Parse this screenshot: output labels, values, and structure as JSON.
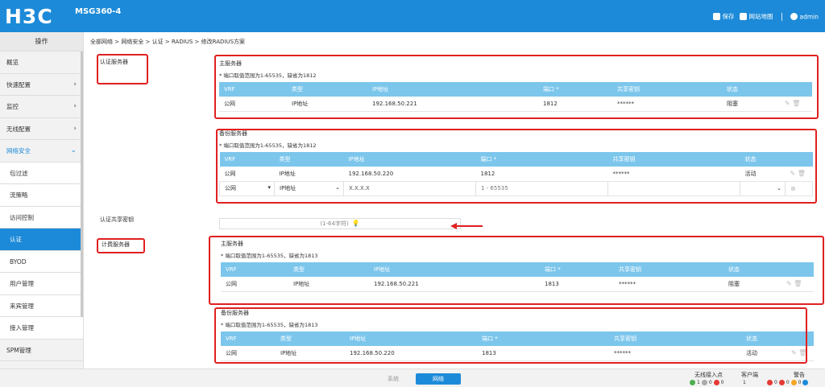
{
  "header": {
    "logo": "H3C",
    "model": "MSG360-4",
    "save_label": "保存",
    "sitemap_label": "网站地图",
    "user_label": "admin"
  },
  "sidebar": {
    "title": "操作",
    "items": [
      {
        "label": "概览",
        "chev": ""
      },
      {
        "label": "快速配置",
        "chev": "›"
      },
      {
        "label": "监控",
        "chev": "›"
      },
      {
        "label": "无线配置",
        "chev": "›"
      },
      {
        "label": "网络安全",
        "chev": "⌄"
      },
      {
        "label": "包过滤",
        "chev": ""
      },
      {
        "label": "流策略",
        "chev": ""
      },
      {
        "label": "访问控制",
        "chev": ""
      },
      {
        "label": "认证",
        "chev": ""
      },
      {
        "label": "BYOD",
        "chev": ""
      },
      {
        "label": "用户管理",
        "chev": ""
      },
      {
        "label": "来宾管理",
        "chev": ""
      },
      {
        "label": "接入管理",
        "chev": ""
      },
      {
        "label": "SPM管理",
        "chev": ""
      }
    ]
  },
  "breadcrumb": "全部网络 > 网络安全 > 认证 > RADIUS > 修改RADIUS方案",
  "labels": {
    "auth_server": "认证服务器",
    "auth_shared_key": "认证共享密钥",
    "acct_server": "计费服务器"
  },
  "columns": [
    "VRF",
    "类型",
    "IP地址",
    "端口 *",
    "共享密钥",
    "状态"
  ],
  "auth_primary": {
    "title": "主服务器",
    "note": "* 端口取值范围为1-65535，缺省为1812",
    "row": {
      "vrf": "公网",
      "type": "IP地址",
      "ip": "192.168.50.221",
      "port": "1812",
      "key": "******",
      "status": "阻塞"
    }
  },
  "auth_backup": {
    "title": "备份服务器",
    "note": "* 端口取值范围为1-65535，缺省为1812",
    "row": {
      "vrf": "公网",
      "type": "IP地址",
      "ip": "192.168.50.220",
      "port": "1812",
      "key": "******",
      "status": "活动"
    },
    "new_row": {
      "vrf": "公网",
      "type": "IP地址",
      "ip_placeholder": "X.X.X.X",
      "port_placeholder": "1 - 65535"
    }
  },
  "shared_key_hint": "(1-64字符)",
  "acct_primary": {
    "title": "主服务器",
    "note": "* 端口取值范围为1-65535，缺省为1813",
    "row": {
      "vrf": "公网",
      "type": "IP地址",
      "ip": "192.168.50.221",
      "port": "1813",
      "key": "******",
      "status": "阻塞"
    }
  },
  "acct_backup": {
    "title": "备份服务器",
    "note": "* 端口取值范围为1-65535，缺省为1813",
    "row": {
      "vrf": "公网",
      "type": "IP地址",
      "ip": "192.168.50.220",
      "port": "1813",
      "key": "******",
      "status": "活动"
    }
  },
  "bottom": {
    "tab_system": "系统",
    "tab_network": "网络",
    "wireless_ap": "无线接入点",
    "clients": "客户端",
    "alarms": "警告",
    "ap_counts": [
      "1",
      "0",
      "0"
    ],
    "client_count": "1",
    "alarm_counts": [
      "0",
      "0",
      "0"
    ]
  },
  "colors": {
    "brand": "#1c8ad8",
    "table_header": "#7cc6ec",
    "highlight": "#e02020"
  }
}
